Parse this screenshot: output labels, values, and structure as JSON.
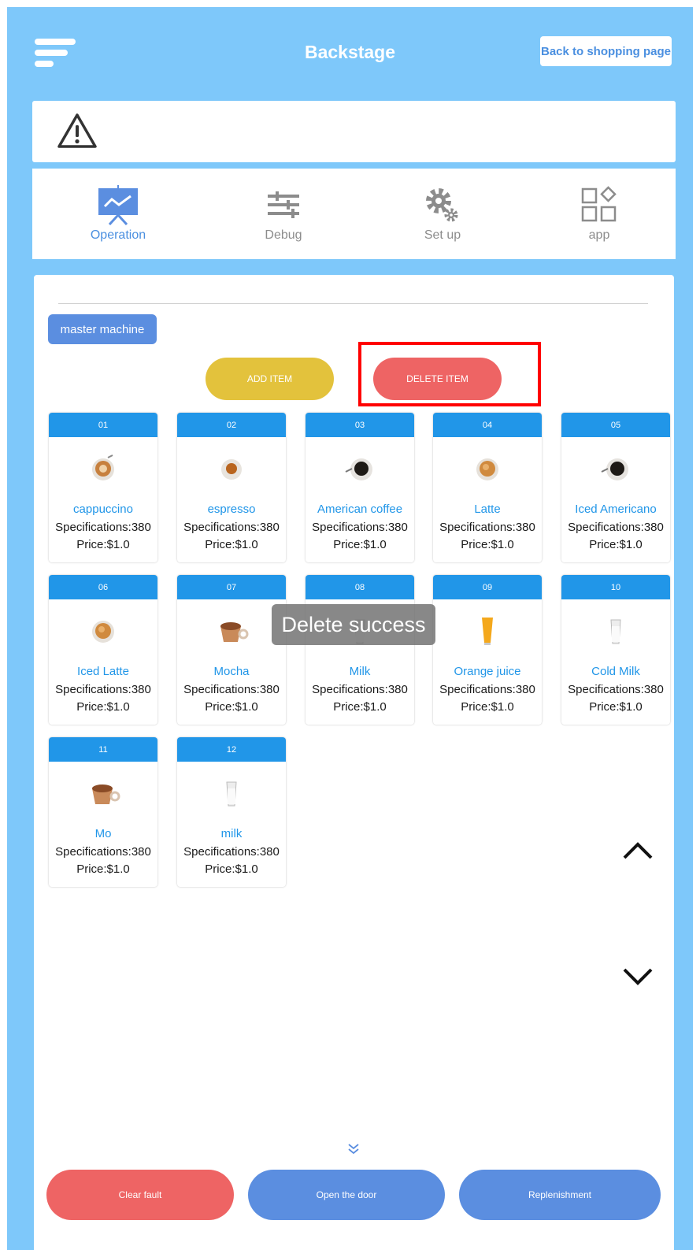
{
  "header": {
    "title": "Backstage",
    "back_label": "Back to shopping page"
  },
  "tabs": [
    {
      "label": "Operation",
      "icon": "presentation-chart-icon",
      "active": true
    },
    {
      "label": "Debug",
      "icon": "sliders-icon",
      "active": false
    },
    {
      "label": "Set up",
      "icon": "gear-icon",
      "active": false
    },
    {
      "label": "app",
      "icon": "apps-grid-icon",
      "active": false
    }
  ],
  "machine": {
    "label": "master machine"
  },
  "actions": {
    "add": "ADD ITEM",
    "delete": "DELETE ITEM"
  },
  "items": [
    {
      "num": "01",
      "name": "cappuccino",
      "spec": "Specifications:380",
      "price": "Price:$1.0",
      "icon": "cappuccino-cup-icon"
    },
    {
      "num": "02",
      "name": "espresso",
      "spec": "Specifications:380",
      "price": "Price:$1.0",
      "icon": "espresso-cup-icon"
    },
    {
      "num": "03",
      "name": "American coffee",
      "spec": "Specifications:380",
      "price": "Price:$1.0",
      "icon": "black-coffee-cup-icon"
    },
    {
      "num": "04",
      "name": "Latte",
      "spec": "Specifications:380",
      "price": "Price:$1.0",
      "icon": "latte-cup-icon"
    },
    {
      "num": "05",
      "name": "Iced Americano",
      "spec": "Specifications:380",
      "price": "Price:$1.0",
      "icon": "black-coffee-cup-icon"
    },
    {
      "num": "06",
      "name": "Iced Latte",
      "spec": "Specifications:380",
      "price": "Price:$1.0",
      "icon": "latte-cup-icon"
    },
    {
      "num": "07",
      "name": "Mocha",
      "spec": "Specifications:380",
      "price": "Price:$1.0",
      "icon": "mocha-cup-icon"
    },
    {
      "num": "08",
      "name": "Milk",
      "spec": "Specifications:380",
      "price": "Price:$1.0",
      "icon": "milk-glass-icon"
    },
    {
      "num": "09",
      "name": "Orange juice",
      "spec": "Specifications:380",
      "price": "Price:$1.0",
      "icon": "orange-juice-glass-icon"
    },
    {
      "num": "10",
      "name": "Cold Milk",
      "spec": "Specifications:380",
      "price": "Price:$1.0",
      "icon": "milk-glass-icon"
    },
    {
      "num": "11",
      "name": "Mo",
      "spec": "Specifications:380",
      "price": "Price:$1.0",
      "icon": "mocha-cup-icon"
    },
    {
      "num": "12",
      "name": "milk",
      "spec": "Specifications:380",
      "price": "Price:$1.0",
      "icon": "milk-glass-icon"
    }
  ],
  "toast": "Delete success",
  "footer": {
    "clear": "Clear fault",
    "open": "Open the door",
    "replenish": "Replenishment"
  },
  "colors": {
    "background": "#7ec8fa",
    "accent": "#2196e8",
    "add": "#e3c23c",
    "delete": "#ee6464",
    "button_blue": "#5b8ee0"
  }
}
